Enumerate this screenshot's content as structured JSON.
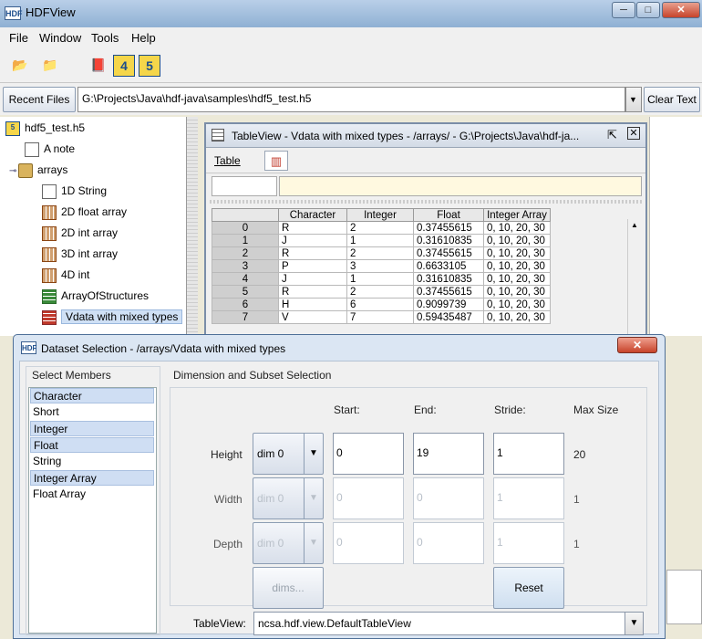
{
  "app": {
    "title": "HDFView",
    "icon_text": "HDF",
    "window_buttons": {
      "minimize": "─",
      "maximize": "□",
      "close": "✕"
    }
  },
  "menu": {
    "items": [
      {
        "label": "File",
        "key": "F"
      },
      {
        "label": "Window",
        "key": "W"
      },
      {
        "label": "Tools",
        "key": "T"
      },
      {
        "label": "Help",
        "key": "H"
      }
    ]
  },
  "toolbar": {
    "buttons": [
      {
        "name": "open-file",
        "glyph": "📂"
      },
      {
        "name": "close-file",
        "glyph": "📁"
      },
      {
        "name": "help",
        "glyph": "📕"
      },
      {
        "name": "hdf4-lib",
        "glyph": "4"
      },
      {
        "name": "hdf5-lib",
        "glyph": "5"
      }
    ]
  },
  "recent": {
    "button_label": "Recent Files",
    "path": "G:\\Projects\\Java\\hdf-java\\samples\\hdf5_test.h5",
    "clear_label": "Clear Text"
  },
  "tree": {
    "items": [
      {
        "label": "hdf5_test.h5",
        "icon": "hdf5-file-icon",
        "level": 0
      },
      {
        "label": "A note",
        "icon": "note-icon",
        "level": 1
      },
      {
        "label": "arrays",
        "icon": "folder-icon",
        "level": 1
      },
      {
        "label": "1D String",
        "icon": "text-dataset-icon",
        "level": 2
      },
      {
        "label": "2D float array",
        "icon": "dataset-icon",
        "level": 2
      },
      {
        "label": "2D int array",
        "icon": "dataset-icon",
        "level": 2
      },
      {
        "label": "3D int array",
        "icon": "dataset-icon",
        "level": 2
      },
      {
        "label": "4D int",
        "icon": "dataset-icon",
        "level": 2
      },
      {
        "label": "ArrayOfStructures",
        "icon": "table-icon",
        "level": 2
      },
      {
        "label": "Vdata with mixed types",
        "icon": "table-icon",
        "level": 2,
        "selected": true
      }
    ]
  },
  "tableview": {
    "title": "TableView  -  Vdata with mixed types  -  /arrays/  -  G:\\Projects\\Java\\hdf-ja...",
    "menu_label": "Table",
    "columns": [
      "Character",
      "Integer",
      "Float",
      "Integer Array"
    ],
    "rows": [
      {
        "index": "0",
        "cells": [
          "R",
          "2",
          "0.37455615",
          "0, 10, 20, 30"
        ]
      },
      {
        "index": "1",
        "cells": [
          "J",
          "1",
          "0.31610835",
          "0, 10, 20, 30"
        ]
      },
      {
        "index": "2",
        "cells": [
          "R",
          "2",
          "0.37455615",
          "0, 10, 20, 30"
        ]
      },
      {
        "index": "3",
        "cells": [
          "P",
          "3",
          "0.6633105",
          "0, 10, 20, 30"
        ]
      },
      {
        "index": "4",
        "cells": [
          "J",
          "1",
          "0.31610835",
          "0, 10, 20, 30"
        ]
      },
      {
        "index": "5",
        "cells": [
          "R",
          "2",
          "0.37455615",
          "0, 10, 20, 30"
        ]
      },
      {
        "index": "6",
        "cells": [
          "H",
          "6",
          "0.9099739",
          "0, 10, 20, 30"
        ]
      },
      {
        "index": "7",
        "cells": [
          "V",
          "7",
          "0.59435487",
          "0, 10, 20, 30"
        ]
      }
    ]
  },
  "dialog": {
    "icon_text": "HDF",
    "title": "Dataset Selection - /arrays/Vdata with mixed types",
    "close_label": "✕",
    "members_title": "Select Members",
    "members": [
      {
        "label": "Character",
        "selected": true
      },
      {
        "label": "Short",
        "selected": false
      },
      {
        "label": "Integer",
        "selected": true
      },
      {
        "label": "Float",
        "selected": true
      },
      {
        "label": "String",
        "selected": false
      },
      {
        "label": "Integer Array",
        "selected": true
      },
      {
        "label": "Float Array",
        "selected": false
      }
    ],
    "dimension_title": "Dimension and Subset Selection",
    "headers": {
      "start": "Start:",
      "end": "End:",
      "stride": "Stride:",
      "max_size": "Max Size"
    },
    "dims": [
      {
        "label": "Height",
        "combo": "dim 0",
        "start": "0",
        "end": "19",
        "stride": "1",
        "max": "20",
        "enabled": true
      },
      {
        "label": "Width",
        "combo": "dim 0",
        "start": "0",
        "end": "0",
        "stride": "1",
        "max": "1",
        "enabled": false
      },
      {
        "label": "Depth",
        "combo": "dim 0",
        "start": "0",
        "end": "0",
        "stride": "1",
        "max": "1",
        "enabled": false
      }
    ],
    "dims_button": "dims...",
    "reset_button": "Reset",
    "tableview_label": "TableView:",
    "tableview_value": "ncsa.hdf.view.DefaultTableView"
  }
}
